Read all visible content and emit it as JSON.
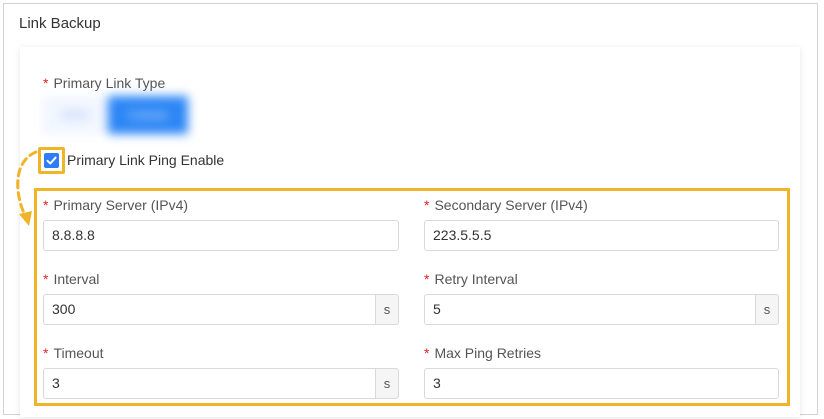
{
  "section": {
    "title": "Link Backup"
  },
  "primary_link_type": {
    "label": "Primary Link Type",
    "options": [
      "WAN",
      "Cellular"
    ],
    "selected": "Cellular"
  },
  "ping_enable": {
    "label": "Primary Link Ping Enable",
    "checked": true
  },
  "fields": {
    "primary_server": {
      "label": "Primary Server (IPv4)",
      "value": "8.8.8.8"
    },
    "secondary_server": {
      "label": "Secondary Server (IPv4)",
      "value": "223.5.5.5"
    },
    "interval": {
      "label": "Interval",
      "value": "300",
      "unit": "s"
    },
    "retry_interval": {
      "label": "Retry Interval",
      "value": "5",
      "unit": "s"
    },
    "timeout": {
      "label": "Timeout",
      "value": "3",
      "unit": "s"
    },
    "max_ping_retries": {
      "label": "Max Ping Retries",
      "value": "3"
    }
  },
  "required_mark": "*",
  "colors": {
    "highlight": "#f0b428",
    "checkbox": "#2e7cf6",
    "required": "#e02424",
    "segment_active": "#2c86f5"
  },
  "icons": {
    "checkbox": "checkmark-icon",
    "annotation": "curved-arrow-icon"
  }
}
